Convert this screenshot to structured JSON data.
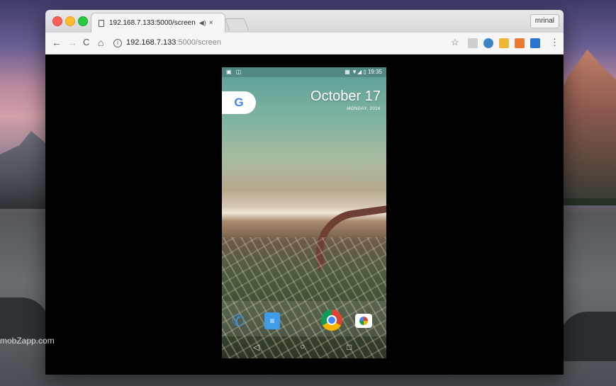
{
  "browser": {
    "tab_title": "192.168.7.133:5000/screen",
    "tab_audio": "◀)",
    "tab_close": "×",
    "profile_name": "mrinal",
    "url_host": "192.168.7.133",
    "url_rest": ":5000/screen",
    "nav": {
      "back": "←",
      "forward": "→",
      "reload": "C",
      "home": "⌂"
    },
    "info_icon": "i",
    "star": "☆",
    "menu": "⋮"
  },
  "watermark": "mobZapp.com",
  "phone": {
    "status_left": "▣ ◫",
    "status_right": "▦ ▼◢ ▯ 19:35",
    "google_letter": "G",
    "date_big": "October 17",
    "date_small": "MONDAY, 2016",
    "messages_glyph": "≡",
    "phone_glyph": "✆",
    "nav_back": "◁",
    "nav_home": "○",
    "nav_recent": "□"
  },
  "colors": {
    "tab_bg": "#f6f6f6",
    "close": "#fc5f57",
    "minimize": "#fdbc2e",
    "maximize": "#28c840",
    "accent_blue": "#4285f4"
  }
}
